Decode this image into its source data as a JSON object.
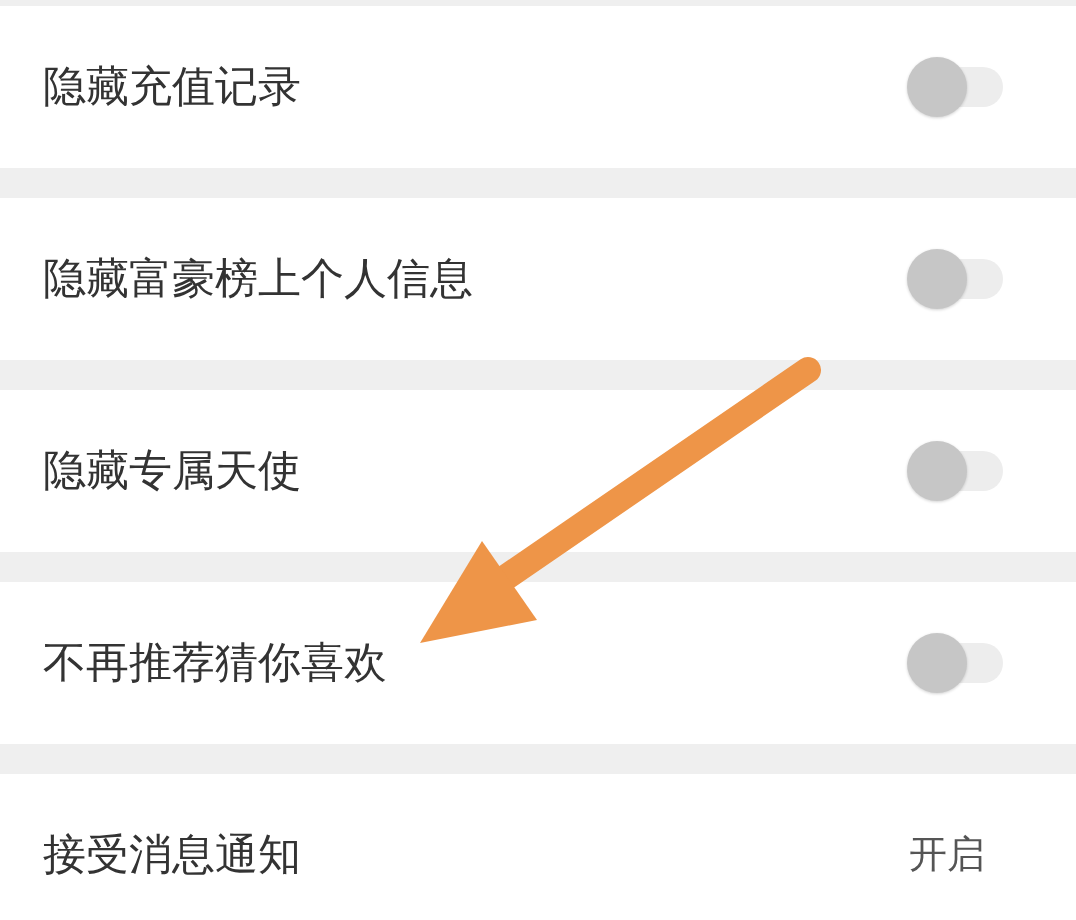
{
  "settings": [
    {
      "label": "隐藏充值记录",
      "kind": "toggle",
      "on": false
    },
    {
      "label": "隐藏富豪榜上个人信息",
      "kind": "toggle",
      "on": false
    },
    {
      "label": "隐藏专属天使",
      "kind": "toggle",
      "on": false
    },
    {
      "label": "不再推荐猜你喜欢",
      "kind": "toggle",
      "on": false
    },
    {
      "label": "接受消息通知",
      "kind": "value",
      "value": "开启"
    }
  ]
}
